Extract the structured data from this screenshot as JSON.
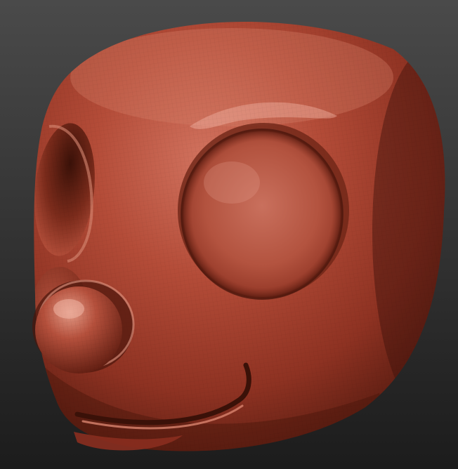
{
  "viewport": {
    "background_top": "#4a4a4a",
    "background_bottom": "#1c1c1c"
  },
  "model": {
    "subject": "sculpted-mascot-head",
    "material_color": "#a8402e",
    "material_highlight": "#e39a86",
    "material_shadow": "#3a1109",
    "wireframe_visible": true
  }
}
